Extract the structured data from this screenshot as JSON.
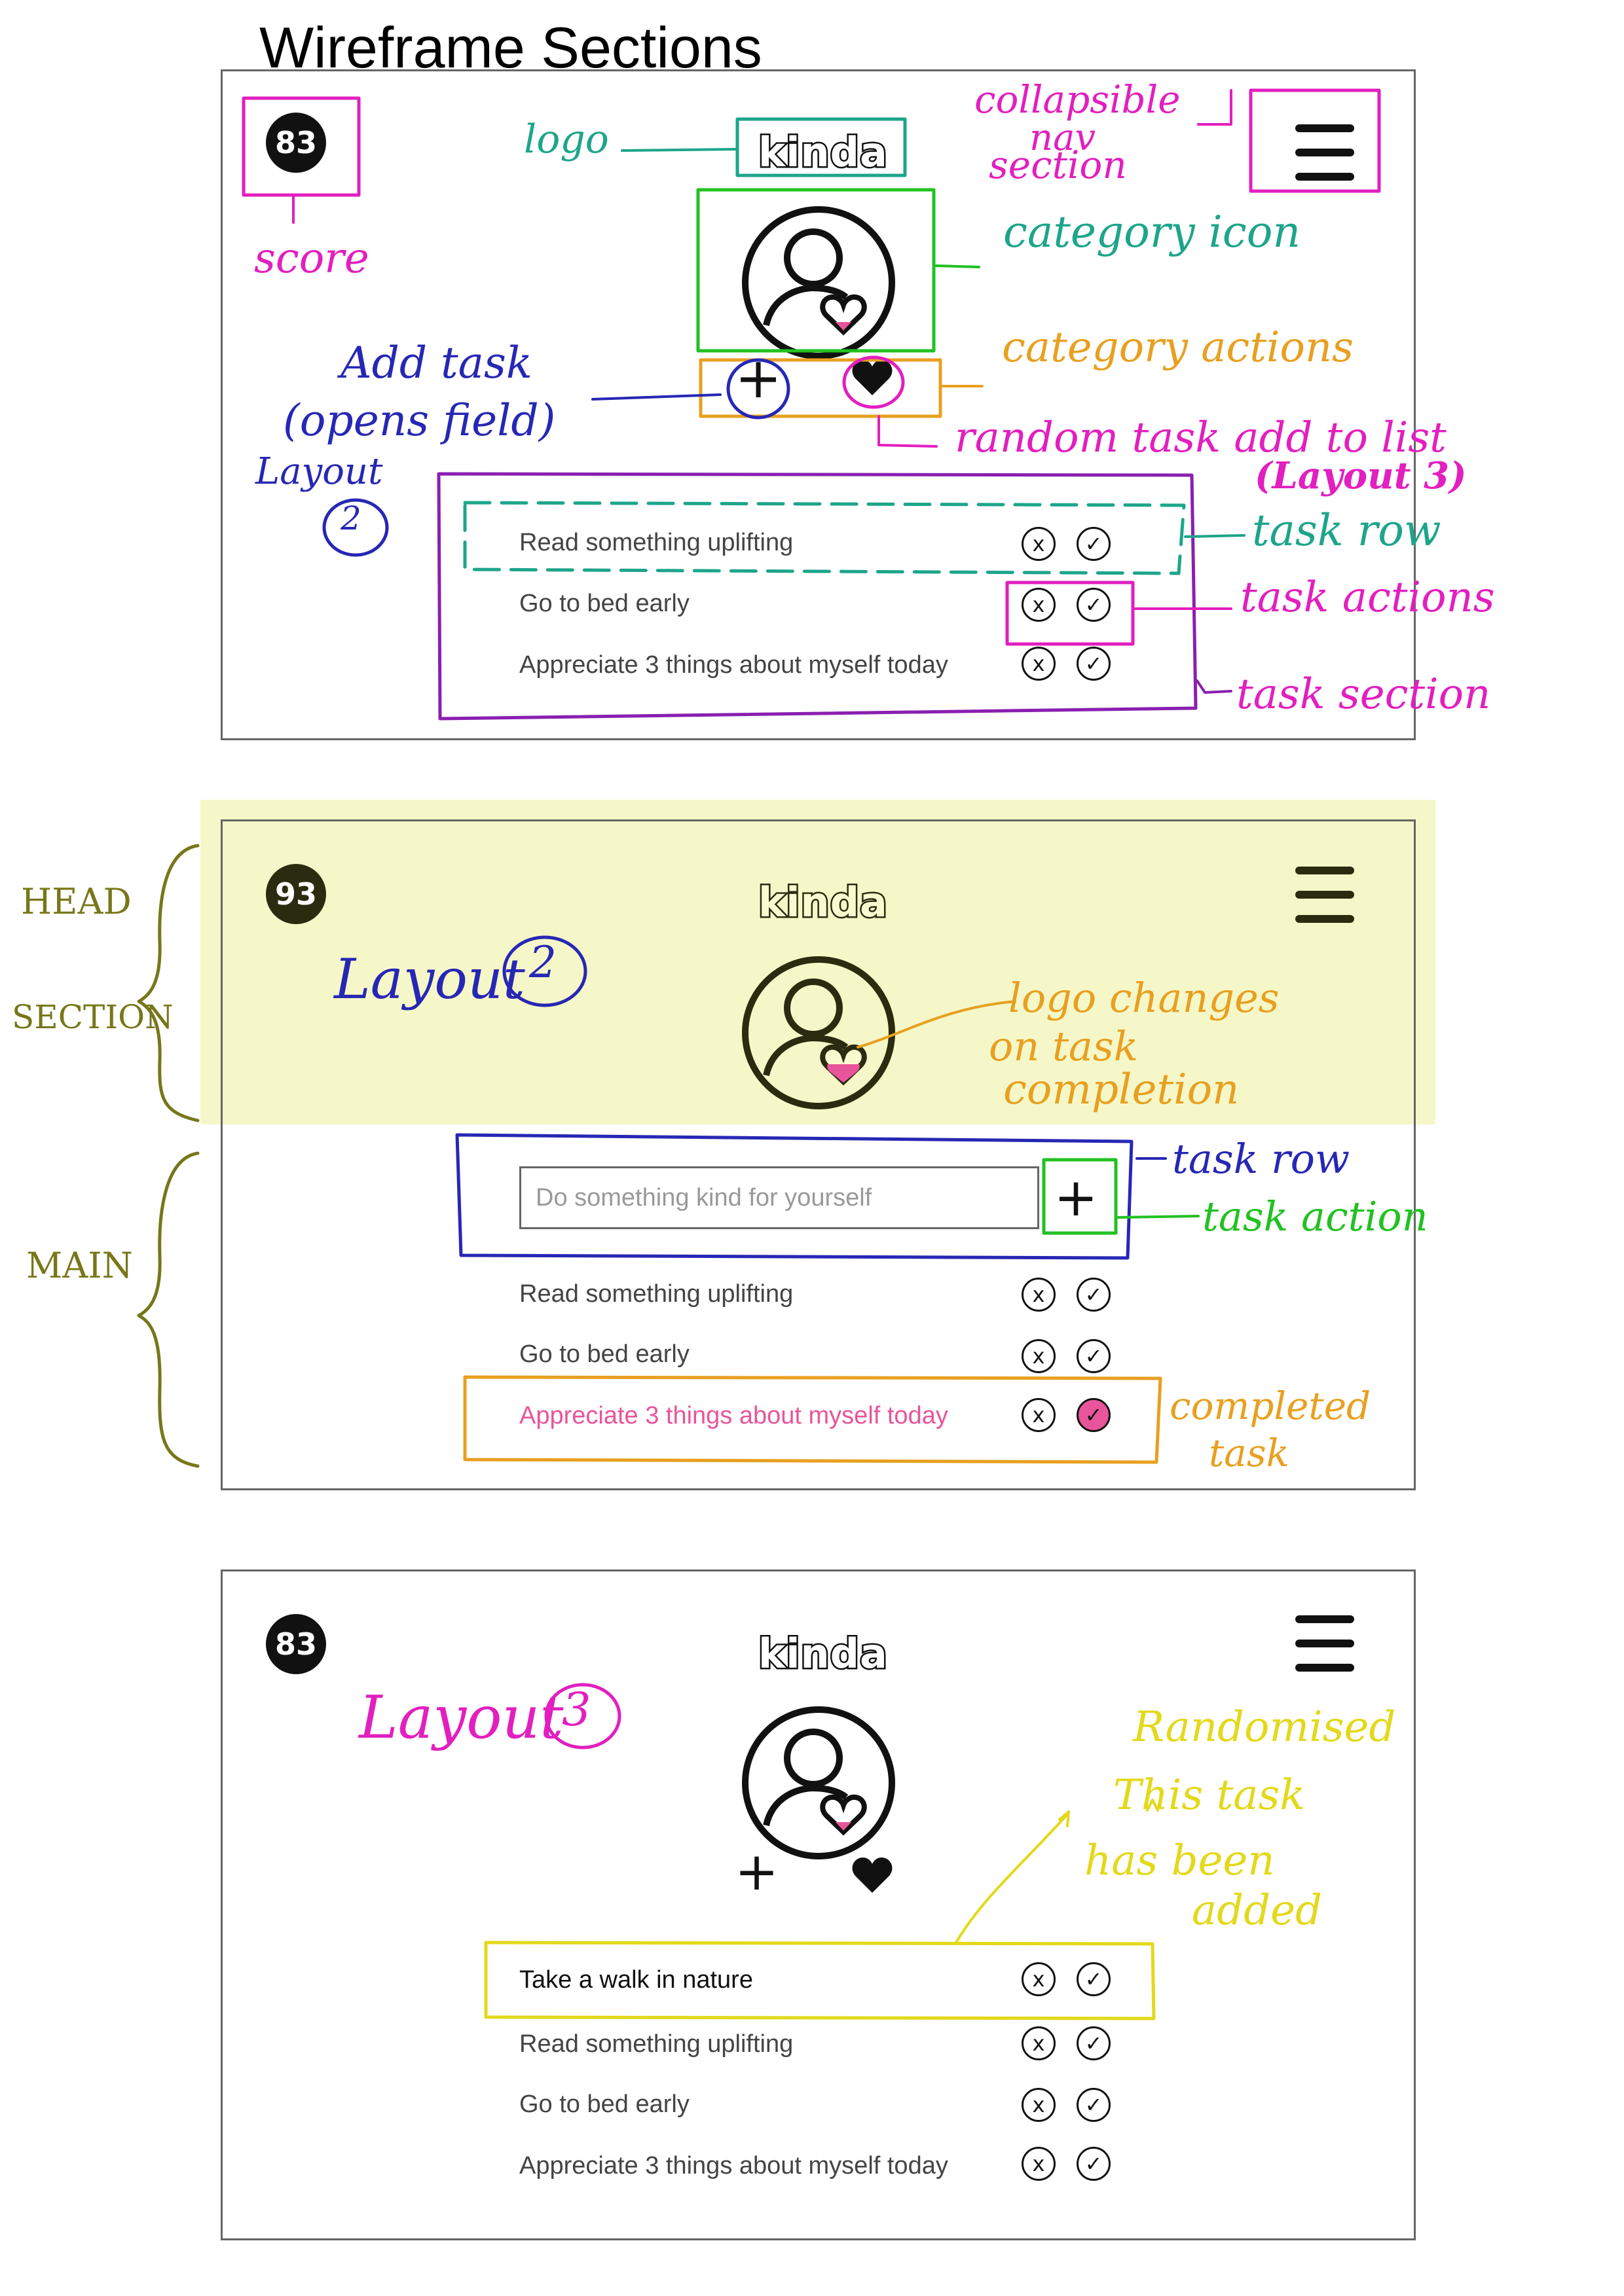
{
  "title": "Wireframe Sections",
  "brand": "kinda",
  "colors": {
    "completed_pink": "#e8559a",
    "annot_pink": "#e21fbf",
    "annot_teal": "#1da58a",
    "annot_orange": "#e8a020",
    "annot_navy": "#2727b5",
    "annot_yellow": "#e3d91a",
    "annot_olive": "#77771a",
    "annot_green": "#22c122",
    "head_highlight": "#f5f7c8"
  },
  "icons": {
    "category": "person-heart-icon",
    "menu": "hamburger-menu-icon",
    "add": "plus-icon",
    "random": "heart-icon",
    "dismiss": "x-circle-icon",
    "complete": "check-circle-icon"
  },
  "action_symbols": {
    "dismiss": "x",
    "complete": "✓"
  },
  "wireframe1": {
    "score": "83",
    "tasks": [
      "Read something uplifting",
      "Go to bed early",
      "Appreciate 3 things about myself today"
    ],
    "annotations": {
      "logo": "logo",
      "score": "score",
      "nav_line1": "collapsible",
      "nav_line2": "nav",
      "nav_line3": "section",
      "category_icon": "category icon",
      "category_actions": "category actions",
      "add_task_line1": "Add task",
      "add_task_line2": "(opens field)",
      "layout_word": "Layout",
      "layout_number": "2",
      "random_task": "random task add to list",
      "random_task_ref": "(Layout 3)",
      "task_row": "task row",
      "task_actions": "task actions",
      "task_section": "task section"
    }
  },
  "wireframe2": {
    "score": "93",
    "input_placeholder": "Do something kind for yourself",
    "add_symbol": "+",
    "tasks": [
      "Read something uplifting",
      "Go to bed early",
      "Appreciate 3 things about myself today"
    ],
    "annotations": {
      "head": "HEAD",
      "section": "SECTION",
      "main": "MAIN",
      "layout_word": "Layout",
      "layout_number": "2",
      "logo_changes_line1": "logo changes",
      "logo_changes_line2": "on task",
      "logo_changes_line3": "completion",
      "task_row": "task row",
      "task_action": "task action",
      "completed_line1": "completed",
      "completed_line2": "task"
    }
  },
  "wireframe3": {
    "score": "83",
    "new_task": "Take a walk in nature",
    "tasks": [
      "Read something uplifting",
      "Go to bed early",
      "Appreciate 3 things about myself today"
    ],
    "annotations": {
      "layout_word": "Layout",
      "layout_number": "3",
      "randomised": "Randomised",
      "this_task": "This task",
      "has_been": "has been",
      "added": "added"
    }
  }
}
